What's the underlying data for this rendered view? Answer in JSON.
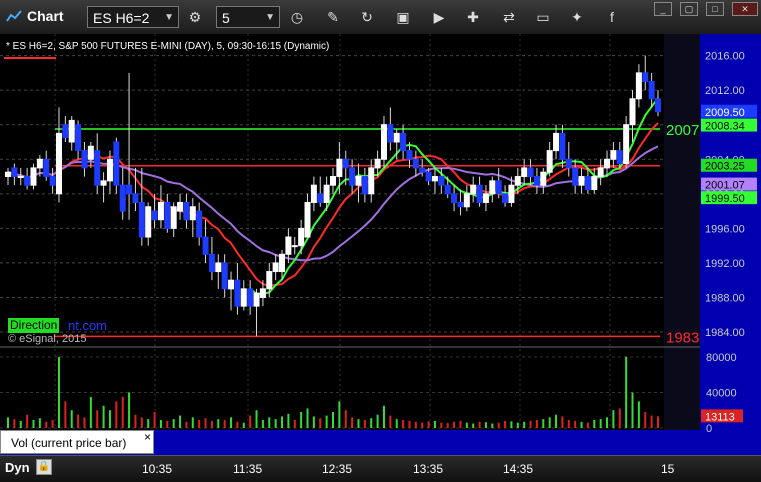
{
  "app": {
    "title": "Chart",
    "symbol": "ES H6=2",
    "interval": "5"
  },
  "chart_header": "* ES H6=2, S&P 500 FUTURES E-MINI (DAY), 5, 09:30-16:15 (Dynamic)",
  "copyright": "© eSignal, 2015",
  "direction_label": "Direction",
  "watermark_fragment": "nt.com",
  "bottom_label": "Dyn",
  "vol_label": "Vol (current price bar)",
  "vol_close": "×",
  "chart_data": {
    "type": "candlestick",
    "price_axis": {
      "ticks": [
        "2016.00",
        "2012.00",
        "2008.00",
        "2004.00",
        "2000.00",
        "1996.00",
        "1992.00",
        "1988.00",
        "1984.00"
      ],
      "range": [
        1982.5,
        2018.5
      ]
    },
    "time_axis": [
      "10:35",
      "11:35",
      "12:35",
      "13:35",
      "14:35",
      "15"
    ],
    "price_labels": [
      {
        "text": "2009.50",
        "price": 2009.5,
        "bg": "#1e3cff",
        "fg": "#ffffff"
      },
      {
        "text": "2008.34",
        "price": 2007.9,
        "bg": "#33ff33",
        "fg": "#000000"
      },
      {
        "text": "2003.25",
        "price": 2003.25,
        "bg": "#22dd22",
        "fg": "#000000"
      },
      {
        "text": "2001.07",
        "price": 2001.07,
        "bg": "#b380ff",
        "fg": "#000000"
      },
      {
        "text": "1999.50",
        "price": 1999.5,
        "bg": "#33ff33",
        "fg": "#000000"
      }
    ],
    "side_levels": [
      {
        "text": "2007",
        "price": 2007.5,
        "color": "#33ff33"
      },
      {
        "text": "1983",
        "price": 1983.5,
        "color": "#ff2a2a"
      }
    ],
    "volume_axis": [
      "80000",
      "40000",
      "0"
    ],
    "volume_range": [
      0,
      90000
    ],
    "volume_current": "13113",
    "horizontal_levels": [
      {
        "price": 2007.5,
        "color": "#33ff33"
      },
      {
        "price": 2003.25,
        "color": "#ff2a2a"
      },
      {
        "price": 1983.5,
        "color": "#ff2a2a"
      }
    ],
    "candles": [
      [
        2002,
        2003,
        2001,
        2002.5
      ],
      [
        2003,
        2003.5,
        2001,
        2002
      ],
      [
        2002,
        2003,
        2001,
        2002
      ],
      [
        2002,
        2003,
        2000.5,
        2001
      ],
      [
        2001,
        2003.5,
        2000.5,
        2003
      ],
      [
        2003,
        2004.5,
        2002,
        2004
      ],
      [
        2004,
        2005,
        2001.5,
        2002
      ],
      [
        2002,
        2003,
        2000,
        2001
      ],
      [
        2000,
        2010,
        1999,
        2007
      ],
      [
        2008,
        2009,
        2006,
        2006.5
      ],
      [
        2006,
        2009,
        2005,
        2008.5
      ],
      [
        2008,
        2008.5,
        2004,
        2005
      ],
      [
        2005,
        2006,
        2002,
        2003
      ],
      [
        2004,
        2006,
        2003,
        2005.5
      ],
      [
        2005,
        2007,
        2000,
        2001
      ],
      [
        2001,
        2002.5,
        1999,
        2001.5
      ],
      [
        2001.5,
        2005,
        2000,
        2004
      ],
      [
        2006,
        2006.5,
        2000,
        2001
      ],
      [
        2001,
        2003,
        1997,
        1998
      ],
      [
        2001,
        2014,
        1997,
        2000
      ],
      [
        2000,
        2003,
        1998,
        1999
      ],
      [
        1999,
        2003,
        1994,
        1995
      ],
      [
        1995,
        1999,
        1994,
        1998.5
      ],
      [
        1998,
        2000,
        1996,
        1997
      ],
      [
        1997,
        2001,
        1996,
        1999
      ],
      [
        1999,
        2000,
        1995.5,
        1996
      ],
      [
        1996,
        1999,
        1995,
        1998.5
      ],
      [
        1998,
        2000,
        1997,
        1999
      ],
      [
        1999,
        2000,
        1996,
        1997
      ],
      [
        1997,
        1999.5,
        1995,
        1998.5
      ],
      [
        1998,
        1999,
        1994,
        1995
      ],
      [
        1995,
        1997,
        1992,
        1993
      ],
      [
        1993,
        1995,
        1990,
        1991
      ],
      [
        1991,
        1993,
        1989,
        1992
      ],
      [
        1992,
        1993,
        1988,
        1989
      ],
      [
        1989,
        1991,
        1986.5,
        1990
      ],
      [
        1990,
        1992,
        1986,
        1987
      ],
      [
        1987,
        1990,
        1986.5,
        1989
      ],
      [
        1989,
        1990,
        1986,
        1987
      ],
      [
        1987,
        1989,
        1983.5,
        1988.5
      ],
      [
        1988,
        1990,
        1987,
        1989
      ],
      [
        1989,
        1992,
        1988,
        1991
      ],
      [
        1991,
        1993,
        1990,
        1992
      ],
      [
        1991,
        1993.5,
        1990,
        1993
      ],
      [
        1993,
        1996,
        1992,
        1995
      ],
      [
        1994,
        1995,
        1993,
        1994
      ],
      [
        1994,
        1997,
        1993,
        1996
      ],
      [
        1995,
        2000,
        1995,
        1999
      ],
      [
        1999,
        2002,
        1998,
        2001
      ],
      [
        2000,
        2002,
        1998.5,
        1999
      ],
      [
        1999,
        2002,
        1998,
        2001
      ],
      [
        2001,
        2003,
        2000,
        2002
      ],
      [
        2002,
        2006,
        2000,
        2004
      ],
      [
        2004,
        2005,
        2001,
        2003
      ],
      [
        2003,
        2004,
        2000,
        2001
      ],
      [
        2001,
        2003.5,
        1999,
        2002
      ],
      [
        2002,
        2003,
        1999,
        2000
      ],
      [
        2000,
        2004,
        1999,
        2003
      ],
      [
        2003,
        2005,
        2002,
        2004
      ],
      [
        2004,
        2009,
        2003,
        2008
      ],
      [
        2008,
        2010,
        2005,
        2006
      ],
      [
        2006,
        2007.5,
        2004,
        2007
      ],
      [
        2007,
        2008,
        2004,
        2005
      ],
      [
        2005,
        2006,
        2003,
        2004
      ],
      [
        2004,
        2005,
        2002,
        2003
      ],
      [
        2003,
        2004,
        2002,
        2002.5
      ],
      [
        2002.5,
        2003,
        2001,
        2001.5
      ],
      [
        2001.5,
        2003,
        2000,
        2002
      ],
      [
        2002,
        2003,
        2000,
        2001
      ],
      [
        2001,
        2002,
        1999.5,
        2000
      ],
      [
        2000,
        2001,
        1998,
        1999
      ],
      [
        1999,
        2000.5,
        1997.5,
        1998.5
      ],
      [
        1998.5,
        2001,
        1998,
        2000
      ],
      [
        2000,
        2002,
        1999,
        2001
      ],
      [
        2001,
        2002,
        1998.5,
        1999
      ],
      [
        1999,
        2001,
        1998,
        2000
      ],
      [
        2000,
        2002,
        1999,
        2001.5
      ],
      [
        2001.5,
        2003,
        1999.5,
        2000
      ],
      [
        2000,
        2001,
        1998.5,
        1999
      ],
      [
        1999,
        2002,
        1998.5,
        2001
      ],
      [
        2001,
        2003,
        2000,
        2002
      ],
      [
        2002,
        2004,
        2001,
        2003
      ],
      [
        2003,
        2004,
        2001,
        2002
      ],
      [
        2002,
        2003,
        2000,
        2001
      ],
      [
        2001,
        2003,
        2000,
        2002.5
      ],
      [
        2002.5,
        2006,
        2002,
        2005
      ],
      [
        2005,
        2008,
        2004,
        2007
      ],
      [
        2007,
        2008,
        2003,
        2004
      ],
      [
        2004,
        2006,
        2002,
        2003
      ],
      [
        2003,
        2004,
        2000,
        2001
      ],
      [
        2001,
        2003,
        2000,
        2002
      ],
      [
        2002,
        2003,
        2000,
        2000.5
      ],
      [
        2000.5,
        2003,
        2000,
        2002
      ],
      [
        2002,
        2004,
        2001,
        2003
      ],
      [
        2003,
        2005,
        2002,
        2004
      ],
      [
        2004,
        2006,
        2003,
        2005
      ],
      [
        2005,
        2006,
        2003,
        2003.5
      ],
      [
        2003.5,
        2009,
        2003,
        2008
      ],
      [
        2008,
        2012,
        2006,
        2011
      ],
      [
        2011,
        2015,
        2010,
        2014
      ],
      [
        2014,
        2016,
        2012,
        2013
      ],
      [
        2013,
        2014,
        2010,
        2011
      ],
      [
        2011,
        2012,
        2009,
        2009.5
      ]
    ],
    "volumes": [
      12000,
      10000,
      8000,
      15000,
      9000,
      11000,
      7000,
      9000,
      80000,
      30000,
      20000,
      15000,
      12000,
      35000,
      20000,
      25000,
      20000,
      30000,
      35000,
      40000,
      15000,
      12000,
      10000,
      18000,
      9000,
      8000,
      10000,
      14000,
      7000,
      12000,
      9000,
      11000,
      8000,
      10000,
      9000,
      12000,
      7000,
      6000,
      14000,
      20000,
      9000,
      12000,
      10000,
      13000,
      16000,
      9000,
      18000,
      22000,
      13000,
      11000,
      14000,
      18000,
      30000,
      20000,
      12000,
      10000,
      9000,
      11000,
      15000,
      25000,
      14000,
      10000,
      9000,
      8000,
      7000,
      6000,
      7500,
      8000,
      6000,
      5500,
      7000,
      8000,
      6000,
      5000,
      7000,
      6500,
      5000,
      6000,
      8000,
      7500,
      6000,
      7000,
      8000,
      9000,
      10000,
      12000,
      15000,
      13000,
      9000,
      8000,
      7000,
      6000,
      9000,
      10000,
      12000,
      20000,
      22000,
      80000,
      40000,
      30000,
      18000,
      14000,
      13113
    ]
  }
}
